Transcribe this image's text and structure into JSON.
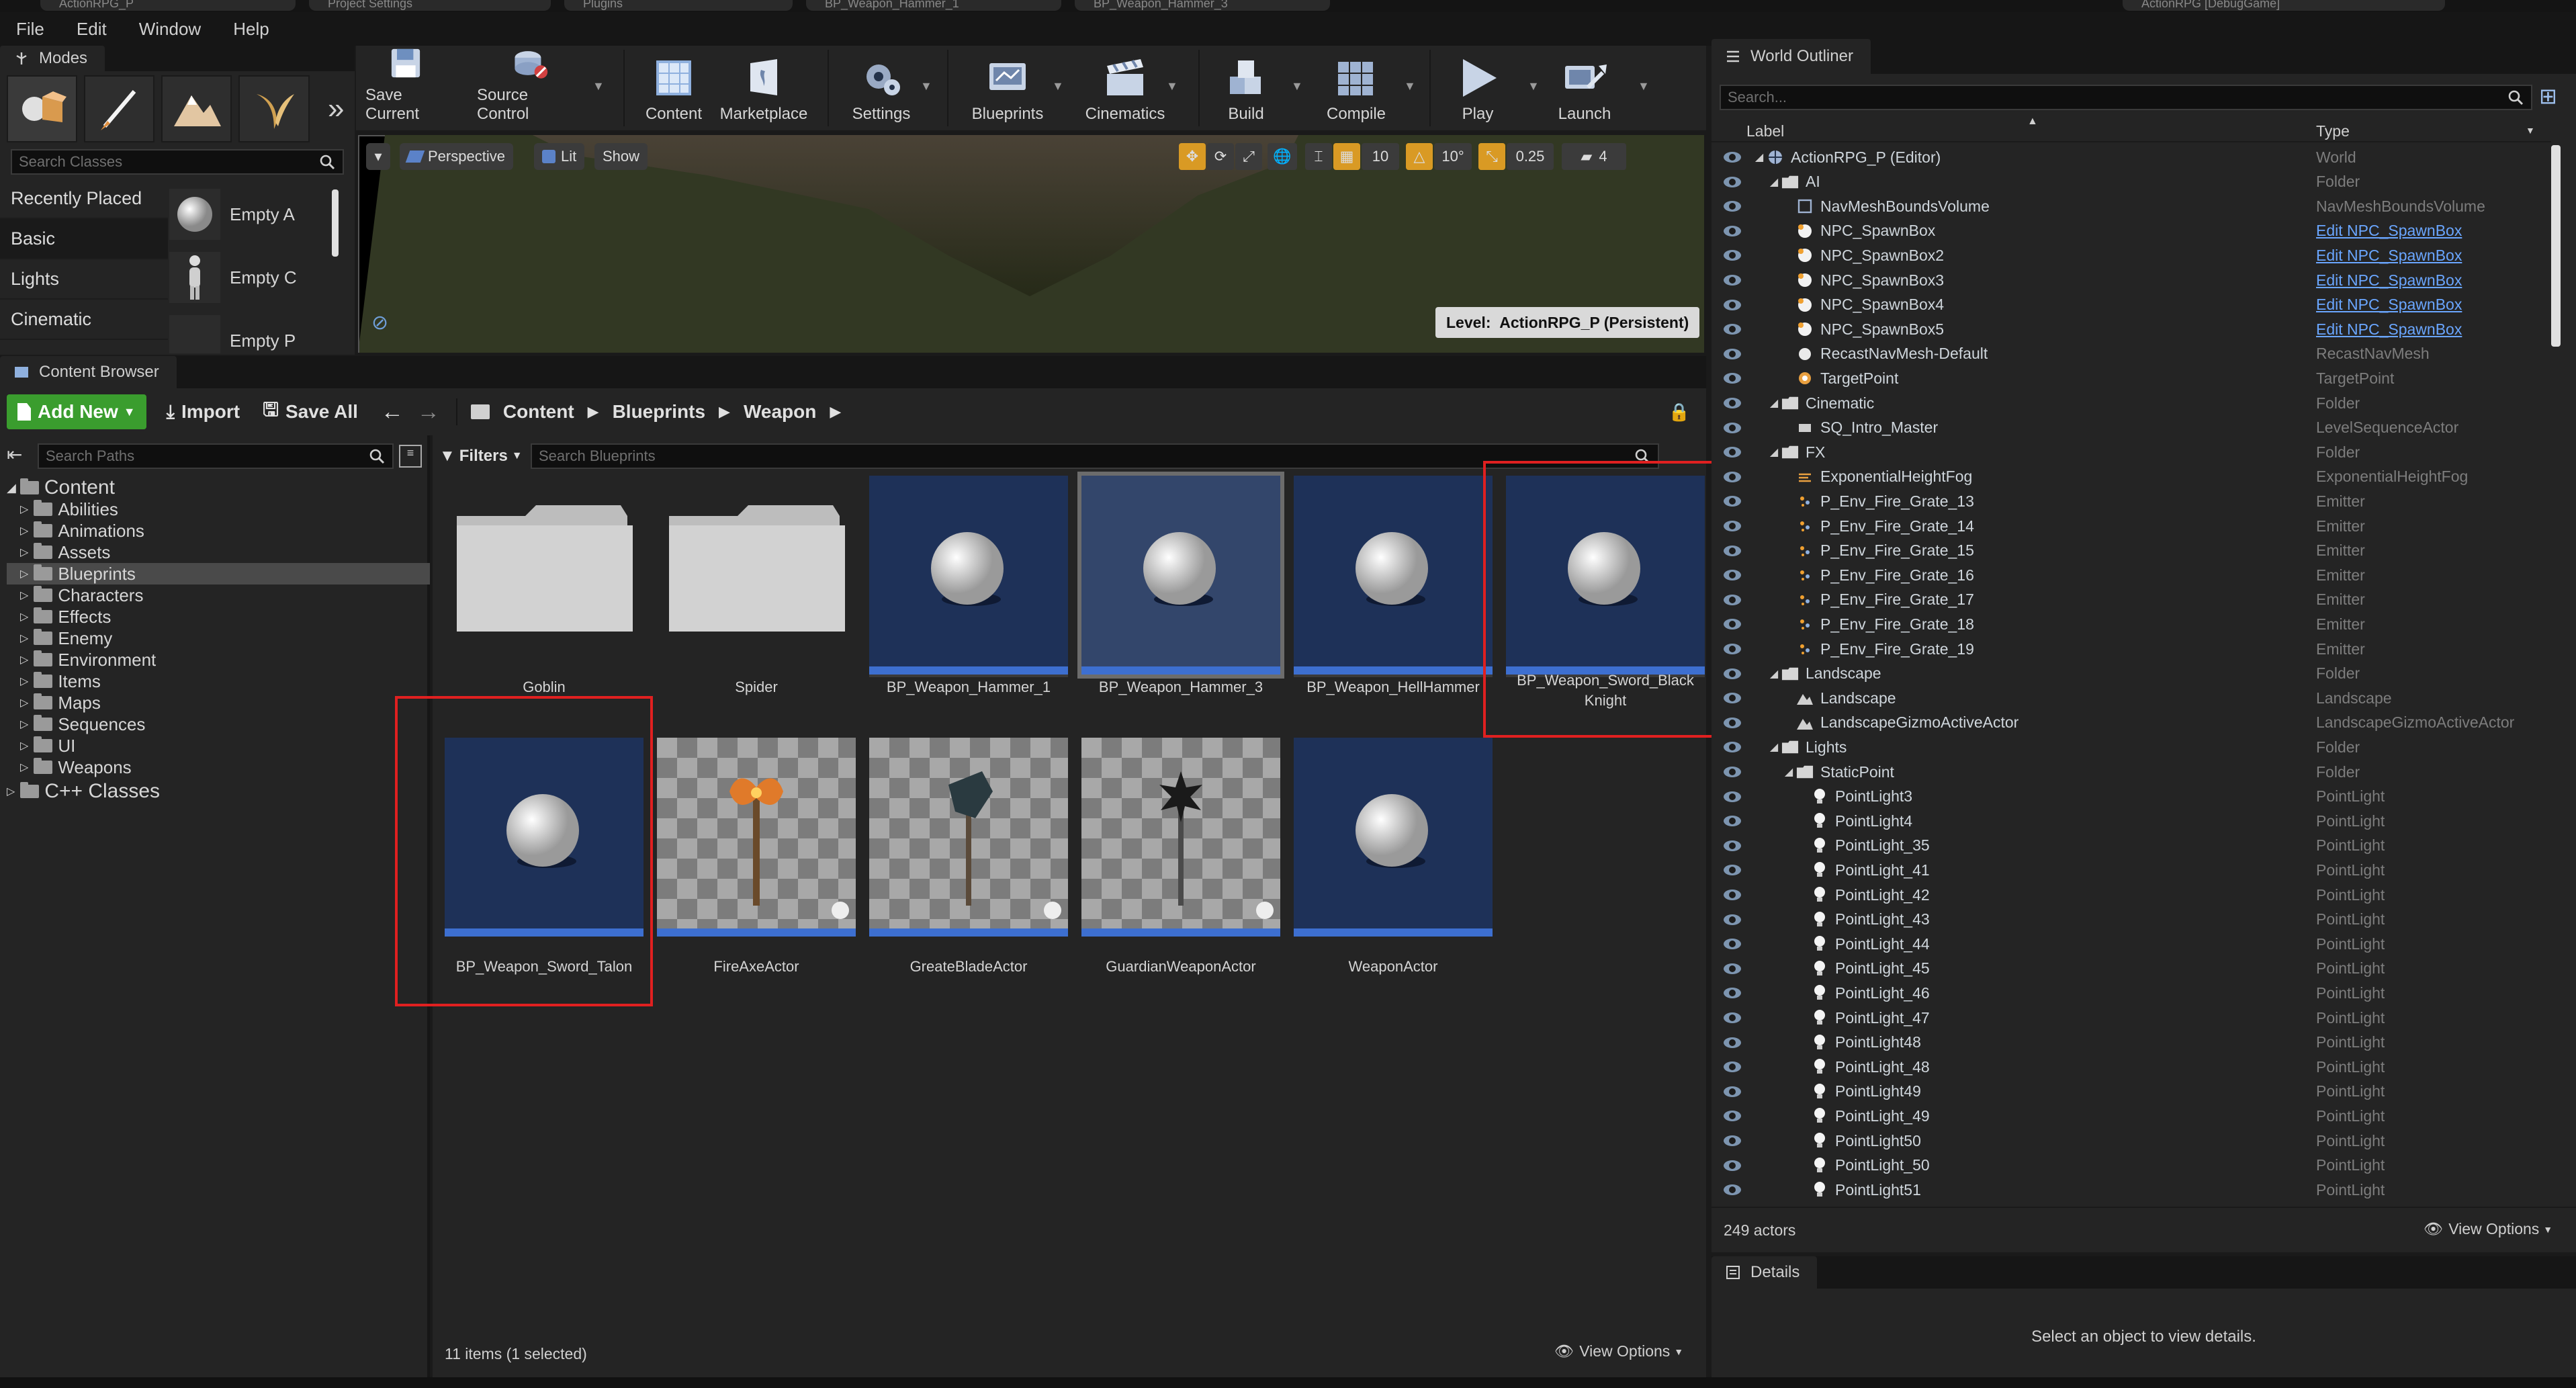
{
  "title_tabs": [
    "ActionRPG_P",
    "Project Settings",
    "Plugins",
    "BP_Weapon_Hammer_1",
    "BP_Weapon_Hammer_3",
    "ActionRPG [DebugGame]"
  ],
  "menu": [
    "File",
    "Edit",
    "Window",
    "Help"
  ],
  "modes": {
    "tab_label": "Modes",
    "search_placeholder": "Search Classes",
    "categories": [
      "Recently Placed",
      "Basic",
      "Lights",
      "Cinematic"
    ],
    "items": [
      "Empty A",
      "Empty C",
      "Empty P"
    ]
  },
  "toolbar": {
    "buttons": [
      "Save Current",
      "Source Control",
      "Content",
      "Marketplace",
      "Settings",
      "Blueprints",
      "Cinematics",
      "Build",
      "Compile",
      "Play",
      "Launch"
    ]
  },
  "viewport": {
    "perspective": "Perspective",
    "lit": "Lit",
    "show": "Show",
    "grid_snap": "10",
    "rot_snap": "10°",
    "scale_snap": "0.25",
    "cam_speed": "4",
    "level_label": "Level:",
    "level_name": "ActionRPG_P (Persistent)"
  },
  "content_browser": {
    "tab_label": "Content Browser",
    "add_new": "Add New",
    "import": "Import",
    "save_all": "Save All",
    "breadcrumb": [
      "Content",
      "Blueprints",
      "Weapon"
    ],
    "search_paths_placeholder": "Search Paths",
    "filters": "Filters",
    "search_assets_placeholder": "Search Blueprints",
    "tree_root": "Content",
    "tree": [
      "Abilities",
      "Animations",
      "Assets",
      "Blueprints",
      "Characters",
      "Effects",
      "Enemy",
      "Environment",
      "Items",
      "Maps",
      "Sequences",
      "UI",
      "Weapons"
    ],
    "tree_cpp": "C++ Classes",
    "assets": [
      {
        "name": "Goblin",
        "kind": "folder"
      },
      {
        "name": "Spider",
        "kind": "folder"
      },
      {
        "name": "BP_Weapon_Hammer_1",
        "kind": "blueprint"
      },
      {
        "name": "BP_Weapon_Hammer_3",
        "kind": "blueprint",
        "selected": true
      },
      {
        "name": "BP_Weapon_HellHammer",
        "kind": "blueprint"
      },
      {
        "name": "BP_Weapon_Sword_Black",
        "name2": "Knight",
        "kind": "blueprint"
      },
      {
        "name": "BP_Weapon_Sword_Talon",
        "kind": "blueprint"
      },
      {
        "name": "FireAxeActor",
        "kind": "actor"
      },
      {
        "name": "GreateBladeActor",
        "kind": "actor"
      },
      {
        "name": "GuardianWeaponActor",
        "kind": "actor"
      },
      {
        "name": "WeaponActor",
        "kind": "blueprint"
      }
    ],
    "item_count": "11 items (1 selected)",
    "view_options": "View Options"
  },
  "outliner": {
    "tab_label": "World Outliner",
    "search_placeholder": "Search...",
    "col_label": "Label",
    "col_type": "Type",
    "rows": [
      {
        "label": "ActionRPG_P (Editor)",
        "type": "World",
        "indent": 0,
        "icon": "world"
      },
      {
        "label": "AI",
        "type": "Folder",
        "indent": 1,
        "icon": "folder"
      },
      {
        "label": "NavMeshBoundsVolume",
        "type": "NavMeshBoundsVolume",
        "indent": 2,
        "icon": "cube"
      },
      {
        "label": "NPC_SpawnBox",
        "type": "Edit NPC_SpawnBox",
        "indent": 2,
        "icon": "bp",
        "link": true
      },
      {
        "label": "NPC_SpawnBox2",
        "type": "Edit NPC_SpawnBox",
        "indent": 2,
        "icon": "bp",
        "link": true
      },
      {
        "label": "NPC_SpawnBox3",
        "type": "Edit NPC_SpawnBox",
        "indent": 2,
        "icon": "bp",
        "link": true
      },
      {
        "label": "NPC_SpawnBox4",
        "type": "Edit NPC_SpawnBox",
        "indent": 2,
        "icon": "bp",
        "link": true
      },
      {
        "label": "NPC_SpawnBox5",
        "type": "Edit NPC_SpawnBox",
        "indent": 2,
        "icon": "bp",
        "link": true
      },
      {
        "label": "RecastNavMesh-Default",
        "type": "RecastNavMesh",
        "indent": 2,
        "icon": "sphere"
      },
      {
        "label": "TargetPoint",
        "type": "TargetPoint",
        "indent": 2,
        "icon": "target"
      },
      {
        "label": "Cinematic",
        "type": "Folder",
        "indent": 1,
        "icon": "folder"
      },
      {
        "label": "SQ_Intro_Master",
        "type": "LevelSequenceActor",
        "indent": 2,
        "icon": "seq"
      },
      {
        "label": "FX",
        "type": "Folder",
        "indent": 1,
        "icon": "folder"
      },
      {
        "label": "ExponentialHeightFog",
        "type": "ExponentialHeightFog",
        "indent": 2,
        "icon": "fog"
      },
      {
        "label": "P_Env_Fire_Grate_13",
        "type": "Emitter",
        "indent": 2,
        "icon": "emitter"
      },
      {
        "label": "P_Env_Fire_Grate_14",
        "type": "Emitter",
        "indent": 2,
        "icon": "emitter"
      },
      {
        "label": "P_Env_Fire_Grate_15",
        "type": "Emitter",
        "indent": 2,
        "icon": "emitter"
      },
      {
        "label": "P_Env_Fire_Grate_16",
        "type": "Emitter",
        "indent": 2,
        "icon": "emitter"
      },
      {
        "label": "P_Env_Fire_Grate_17",
        "type": "Emitter",
        "indent": 2,
        "icon": "emitter"
      },
      {
        "label": "P_Env_Fire_Grate_18",
        "type": "Emitter",
        "indent": 2,
        "icon": "emitter"
      },
      {
        "label": "P_Env_Fire_Grate_19",
        "type": "Emitter",
        "indent": 2,
        "icon": "emitter"
      },
      {
        "label": "Landscape",
        "type": "Folder",
        "indent": 1,
        "icon": "folder"
      },
      {
        "label": "Landscape",
        "type": "Landscape",
        "indent": 2,
        "icon": "landscape"
      },
      {
        "label": "LandscapeGizmoActiveActor",
        "type": "LandscapeGizmoActiveActor",
        "indent": 2,
        "icon": "landscape"
      },
      {
        "label": "Lights",
        "type": "Folder",
        "indent": 1,
        "icon": "folder"
      },
      {
        "label": "StaticPoint",
        "type": "Folder",
        "indent": 2,
        "icon": "folder"
      },
      {
        "label": "PointLight3",
        "type": "PointLight",
        "indent": 3,
        "icon": "light"
      },
      {
        "label": "PointLight4",
        "type": "PointLight",
        "indent": 3,
        "icon": "light"
      },
      {
        "label": "PointLight_35",
        "type": "PointLight",
        "indent": 3,
        "icon": "light"
      },
      {
        "label": "PointLight_41",
        "type": "PointLight",
        "indent": 3,
        "icon": "light"
      },
      {
        "label": "PointLight_42",
        "type": "PointLight",
        "indent": 3,
        "icon": "light"
      },
      {
        "label": "PointLight_43",
        "type": "PointLight",
        "indent": 3,
        "icon": "light"
      },
      {
        "label": "PointLight_44",
        "type": "PointLight",
        "indent": 3,
        "icon": "light"
      },
      {
        "label": "PointLight_45",
        "type": "PointLight",
        "indent": 3,
        "icon": "light"
      },
      {
        "label": "PointLight_46",
        "type": "PointLight",
        "indent": 3,
        "icon": "light"
      },
      {
        "label": "PointLight_47",
        "type": "PointLight",
        "indent": 3,
        "icon": "light"
      },
      {
        "label": "PointLight48",
        "type": "PointLight",
        "indent": 3,
        "icon": "light"
      },
      {
        "label": "PointLight_48",
        "type": "PointLight",
        "indent": 3,
        "icon": "light"
      },
      {
        "label": "PointLight49",
        "type": "PointLight",
        "indent": 3,
        "icon": "light"
      },
      {
        "label": "PointLight_49",
        "type": "PointLight",
        "indent": 3,
        "icon": "light"
      },
      {
        "label": "PointLight50",
        "type": "PointLight",
        "indent": 3,
        "icon": "light"
      },
      {
        "label": "PointLight_50",
        "type": "PointLight",
        "indent": 3,
        "icon": "light"
      },
      {
        "label": "PointLight51",
        "type": "PointLight",
        "indent": 3,
        "icon": "light"
      }
    ],
    "actor_count": "249 actors",
    "view_options": "View Options"
  },
  "details": {
    "tab_label": "Details",
    "empty_message": "Select an object to view details."
  },
  "colors": {
    "selection_red": "#e02020",
    "link_blue": "#6aa6ff",
    "blueprint_bg": "#1e3158",
    "blueprint_bar": "#3d6fd0",
    "add_new_green": "#3a9d2e"
  }
}
